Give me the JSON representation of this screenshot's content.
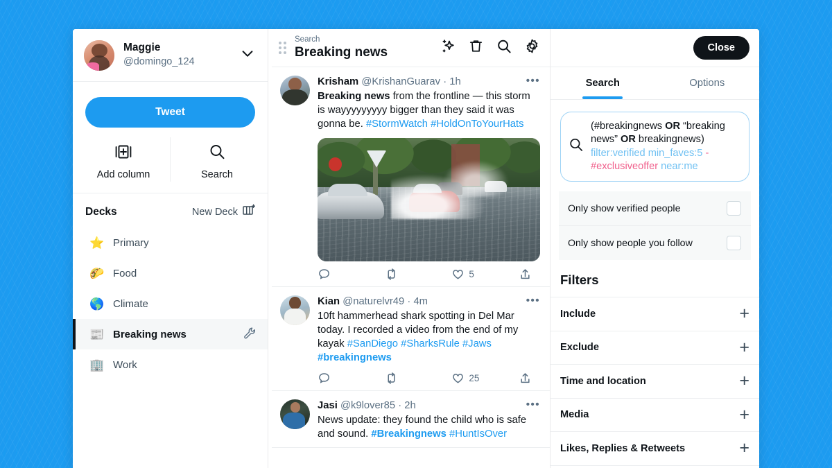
{
  "account": {
    "name": "Maggie",
    "handle": "@domingo_124",
    "chevron_icon": "chevron-down-icon",
    "avatar_alt": "maggie-avatar"
  },
  "sidebar": {
    "tweet_button": "Tweet",
    "quick_actions": [
      {
        "label": "Add column",
        "icon": "add-column-icon"
      },
      {
        "label": "Search",
        "icon": "search-icon"
      }
    ],
    "decks_title": "Decks",
    "new_deck_label": "New Deck",
    "new_deck_icon": "new-deck-icon",
    "decks": [
      {
        "label": "Primary",
        "emoji": "⭐",
        "active": false
      },
      {
        "label": "Food",
        "emoji": "🌮",
        "active": false
      },
      {
        "label": "Climate",
        "emoji": "🌎",
        "active": false
      },
      {
        "label": "Breaking news",
        "emoji": "📰",
        "active": true
      },
      {
        "label": "Work",
        "emoji": "🏢",
        "active": false
      }
    ]
  },
  "column": {
    "kicker": "Search",
    "title": "Breaking news",
    "drag_handle_icon": "drag-handle-icon",
    "icons": [
      {
        "name": "sparkles-icon"
      },
      {
        "name": "trash-icon"
      },
      {
        "name": "search-icon"
      },
      {
        "name": "gear-icon"
      }
    ],
    "tweets": [
      {
        "name": "Krisham",
        "handle": "@KrishanGuarav",
        "time": "1h",
        "avatar_alt": "krisham-avatar",
        "more_icon": "more-options-icon",
        "text_lead": "Breaking news",
        "text_body": " from the frontline — this storm is wayyyyyyyyy bigger than they said it was gonna be. ",
        "tags": [
          "#StormWatch",
          "#HoldOnToYourHats"
        ],
        "has_media": true,
        "media_alt": "flooded-street-photo",
        "actions": {
          "reply": "",
          "retweet": "",
          "like": "5",
          "share": ""
        }
      },
      {
        "name": "Kian",
        "handle": "@naturelvr49",
        "time": "4m",
        "avatar_alt": "kian-avatar",
        "more_icon": "more-options-icon",
        "text_lead": "",
        "text_body": "10ft hammerhead shark spotting in Del Mar today. I recorded a video from the end of my kayak ",
        "tags": [
          "#SanDiego",
          "#SharksRule",
          "#Jaws",
          "#breakingnews"
        ],
        "has_media": false,
        "actions": {
          "reply": "",
          "retweet": "",
          "like": "25",
          "share": ""
        }
      },
      {
        "name": "Jasi",
        "handle": "@k9lover85",
        "time": "2h",
        "avatar_alt": "jasi-avatar",
        "more_icon": "more-options-icon",
        "text_lead": "",
        "text_body": "News update: they found the child who is safe and sound. ",
        "tags": [
          "#Breakingnews",
          "#HuntIsOver"
        ],
        "has_media": false,
        "actions": {
          "reply": "",
          "retweet": "",
          "like": "",
          "share": ""
        }
      }
    ]
  },
  "panel": {
    "close_label": "Close",
    "tabs": [
      {
        "label": "Search",
        "active": true
      },
      {
        "label": "Options",
        "active": false
      }
    ],
    "search_icon": "search-icon",
    "query": {
      "line1_a": "(#breakingnews ",
      "line1_op": "OR",
      "line1_b": " “breaking",
      "line2_a": "news” ",
      "line2_op": "OR",
      "line2_b": " breakingnews)",
      "line3": "filter:verified min_faves:5",
      "line4_neg": "-#exclusiveoffer",
      "line4_pos": " near:me"
    },
    "checks": [
      {
        "label": "Only show verified people",
        "checked": false
      },
      {
        "label": "Only show people you follow",
        "checked": false
      }
    ],
    "filters_title": "Filters",
    "filters": [
      {
        "label": "Include",
        "expand_icon": "plus-icon"
      },
      {
        "label": "Exclude",
        "expand_icon": "plus-icon"
      },
      {
        "label": "Time and location",
        "expand_icon": "plus-icon"
      },
      {
        "label": "Media",
        "expand_icon": "plus-icon"
      },
      {
        "label": "Likes, Replies & Retweets",
        "expand_icon": "plus-icon"
      }
    ]
  },
  "colors": {
    "brand_blue": "#1d9bf0",
    "text_dark": "#0f1419",
    "text_muted": "#5b7083",
    "query_blue": "#6fc0f2",
    "query_pink": "#f0608c",
    "close_black": "#0f1419"
  }
}
